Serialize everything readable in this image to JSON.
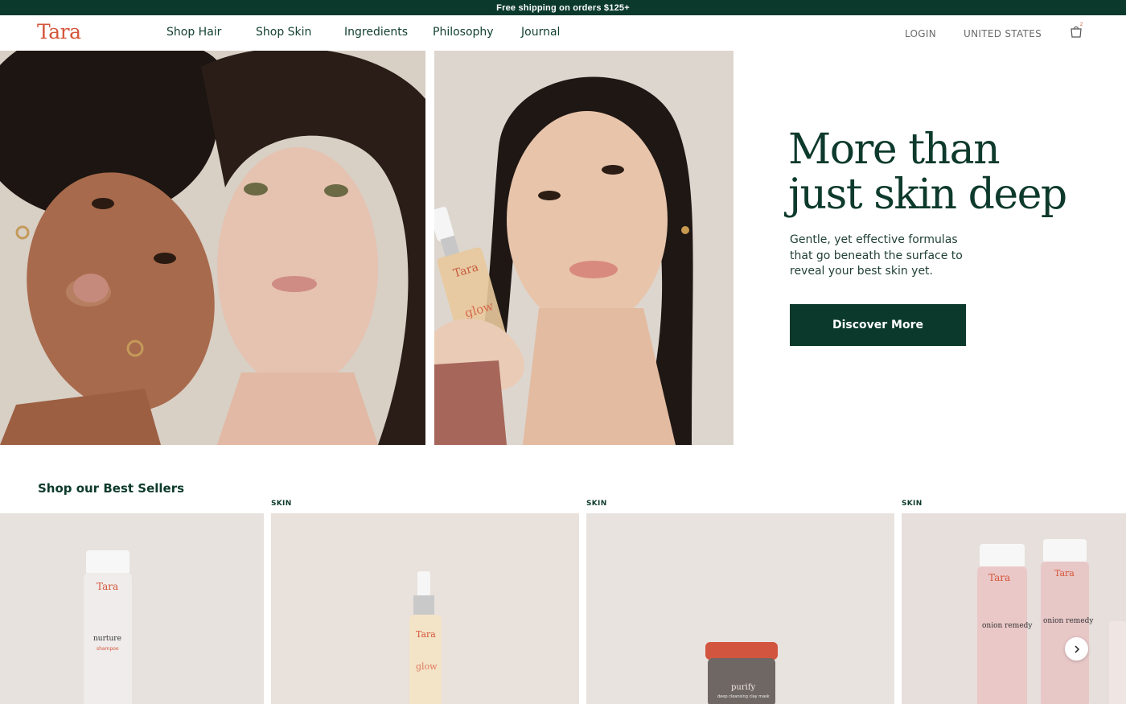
{
  "announcement": "Free shipping on orders $125+",
  "brand": {
    "logo": "Tara",
    "color": "#d4553a"
  },
  "nav": {
    "items": [
      "Shop Hair",
      "Shop Skin",
      "Ingredients",
      "Philosophy",
      "Journal"
    ],
    "login": "LOGIN",
    "region": "UNITED STATES",
    "cart_count": "2"
  },
  "hero": {
    "title_line1": "More than",
    "title_line2": "just skin deep",
    "subtitle": "Gentle, yet effective formulas that go beneath the surface to reveal your best skin yet.",
    "cta": "Discover More",
    "bottle_brand": "Tara",
    "bottle_name": "glow"
  },
  "bestsellers": {
    "title": "Shop our Best Sellers",
    "products": [
      {
        "tag": "",
        "brand": "Tara",
        "name": "nurture",
        "type": "shampoo"
      },
      {
        "tag": "SKIN",
        "brand": "Tara",
        "name": "glow",
        "type": ""
      },
      {
        "tag": "SKIN",
        "brand": "Tara",
        "name": "purify",
        "type": "deep cleansing clay mask"
      },
      {
        "tag": "SKIN",
        "brand": "Tara",
        "name": "onion remedy",
        "type": ""
      }
    ]
  },
  "colors": {
    "dark_green": "#0b3a2c",
    "accent": "#d4553a"
  }
}
